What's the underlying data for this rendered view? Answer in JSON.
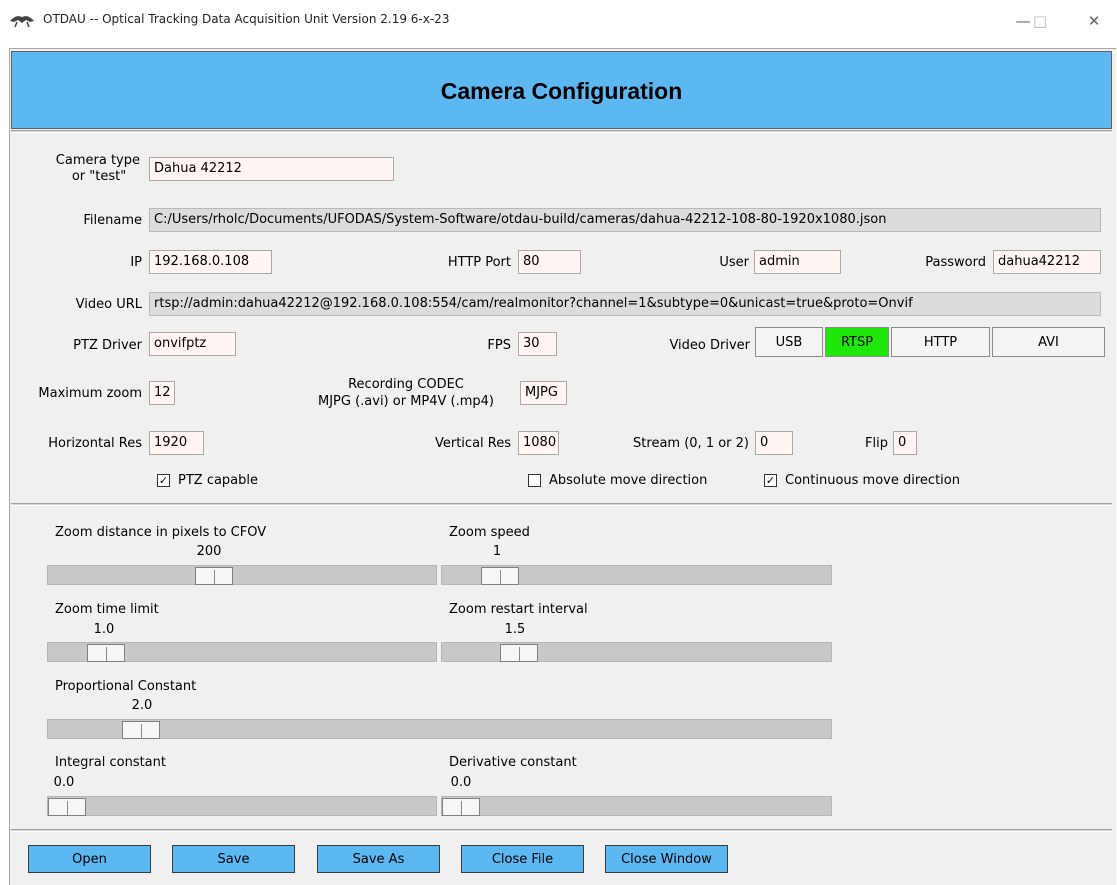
{
  "window": {
    "title": "OTDAU -- Optical Tracking Data Acquisition Unit   Version 2.19 6-x-23",
    "minimize_glyph": "—",
    "maximize_glyph": "□",
    "close_glyph": "✕"
  },
  "header": {
    "title": "Camera Configuration"
  },
  "form": {
    "camera_type_label_1": "Camera type",
    "camera_type_label_2": "or \"test\"",
    "camera_type": "Dahua 42212",
    "filename_label": "Filename",
    "filename": "C:/Users/rholc/Documents/UFODAS/System-Software/otdau-build/cameras/dahua-42212-108-80-1920x1080.json",
    "ip_label": "IP",
    "ip": "192.168.0.108",
    "http_port_label": "HTTP Port",
    "http_port": "80",
    "user_label": "User",
    "user": "admin",
    "password_label": "Password",
    "password": "dahua42212",
    "video_url_label": "Video URL",
    "video_url": "rtsp://admin:dahua42212@192.168.0.108:554/cam/realmonitor?channel=1&subtype=0&unicast=true&proto=Onvif",
    "ptz_driver_label": "PTZ Driver",
    "ptz_driver": "onvifptz",
    "fps_label": "FPS",
    "fps": "30",
    "video_driver_label": "Video Driver",
    "video_drivers": [
      {
        "label": "USB",
        "selected": false
      },
      {
        "label": "RTSP",
        "selected": true
      },
      {
        "label": "HTTP",
        "selected": false
      },
      {
        "label": "AVI",
        "selected": false
      }
    ],
    "max_zoom_label": "Maximum zoom",
    "max_zoom": "12",
    "codec_label_1": "Recording CODEC",
    "codec_label_2": "MJPG (.avi) or MP4V (.mp4)",
    "codec": "MJPG",
    "hres_label": "Horizontal Res",
    "hres": "1920",
    "vres_label": "Vertical Res",
    "vres": "1080",
    "stream_label": "Stream (0, 1 or 2)",
    "stream": "0",
    "flip_label": "Flip",
    "flip": "0",
    "ptz_capable_label": "PTZ capable",
    "ptz_capable": true,
    "absolute_move_label": "Absolute move direction",
    "absolute_move": false,
    "continuous_move_label": "Continuous move direction",
    "continuous_move": true
  },
  "sliders": [
    {
      "label": "Zoom distance in pixels to CFOV",
      "value": "200",
      "position": 0.38
    },
    {
      "label": "Zoom speed",
      "value": "1",
      "position": 0.1
    },
    {
      "label": "Zoom time limit",
      "value": "1.0",
      "position": 0.1
    },
    {
      "label": "Zoom restart interval",
      "value": "1.5",
      "position": 0.15
    },
    {
      "label": "Proportional Constant",
      "value": "2.0",
      "position": 0.095
    },
    {
      "label": "Integral constant",
      "value": "0.0",
      "position": 0
    },
    {
      "label": "Derivative constant",
      "value": "0.0",
      "position": 0
    }
  ],
  "buttons": {
    "open": "Open",
    "save": "Save",
    "save_as": "Save As",
    "close_file": "Close File",
    "close_window": "Close Window"
  },
  "colors": {
    "header_blue": "#5bb8f1",
    "selected_green": "#1ee80a",
    "field_bg": "#fff5f2"
  }
}
